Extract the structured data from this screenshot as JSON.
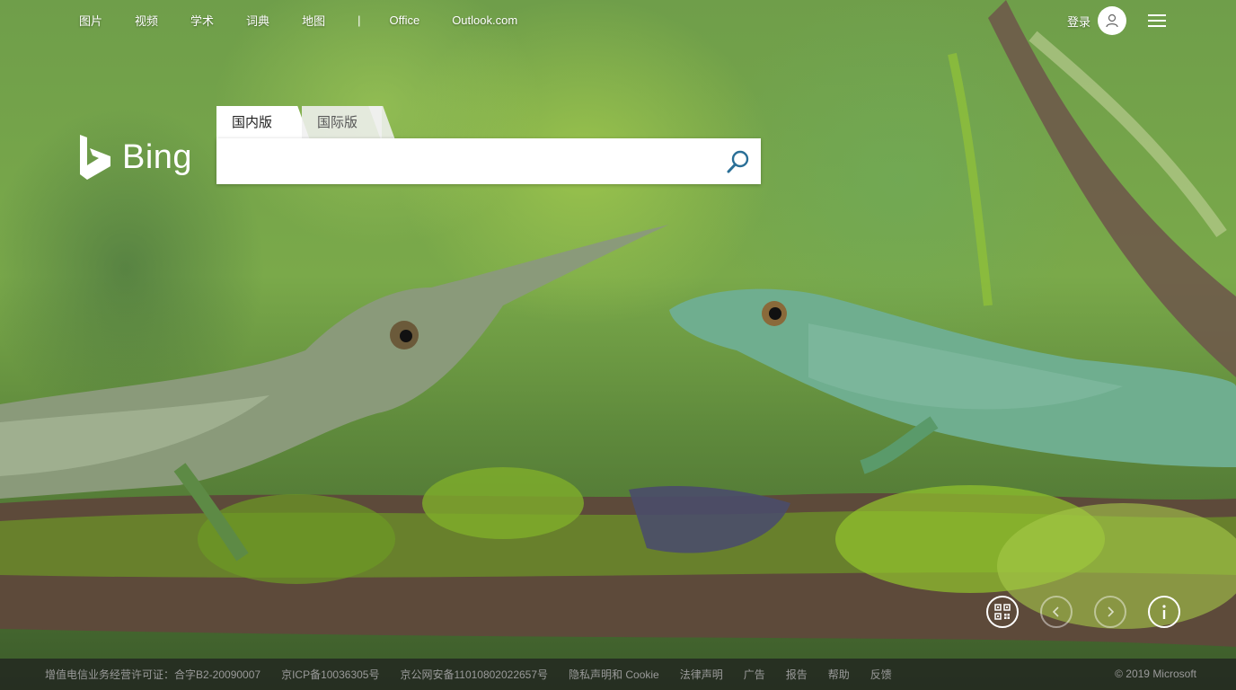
{
  "nav": {
    "items": [
      "图片",
      "视频",
      "学术",
      "词典",
      "地图"
    ],
    "separator": "|",
    "office": "Office",
    "outlook": "Outlook.com"
  },
  "account": {
    "signin": "登录"
  },
  "logo": {
    "text": "Bing"
  },
  "search": {
    "tabs": [
      {
        "label": "国内版",
        "active": true
      },
      {
        "label": "国际版",
        "active": false
      }
    ],
    "value": ""
  },
  "controls": [
    "qr-code-icon",
    "previous-icon",
    "next-icon",
    "info-icon"
  ],
  "footer": {
    "links": [
      "增值电信业务经营许可证：合字B2-20090007",
      "京ICP备10036305号",
      "京公网安备11010802022657号",
      "隐私声明和 Cookie",
      "法律声明",
      "广告",
      "报告",
      "帮助",
      "反馈"
    ],
    "copyright": "© 2019 Microsoft"
  },
  "colors": {
    "accent": "#2a6f97",
    "footer_bg": "#2b2b2b",
    "footer_text": "#9a9a9a"
  }
}
